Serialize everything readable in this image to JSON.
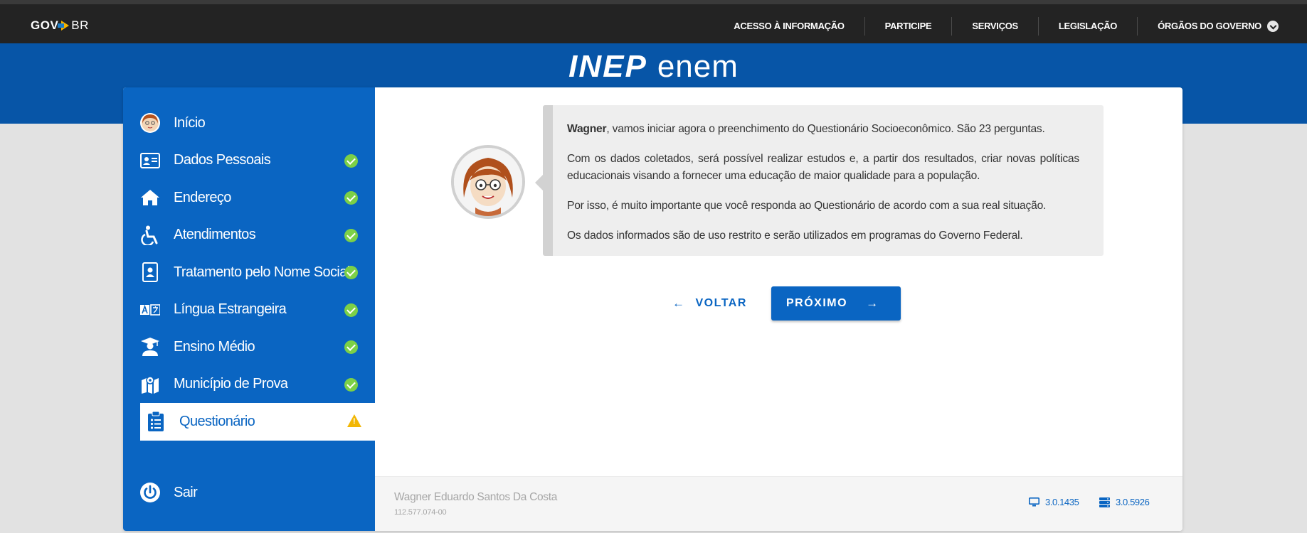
{
  "gov_bar": {
    "logo_gov": "GOV",
    "logo_br": "BR",
    "nav": [
      "ACESSO À INFORMAÇÃO",
      "PARTICIPE",
      "SERVIÇOS",
      "LEGISLAÇÃO",
      "ÓRGÃOS DO GOVERNO"
    ]
  },
  "brand": {
    "inep": "INEP",
    "enem": "enem"
  },
  "sidebar": {
    "items": [
      {
        "label": "Início",
        "icon": "avatar-icon",
        "status": "none"
      },
      {
        "label": "Dados Pessoais",
        "icon": "id-card-icon",
        "status": "complete"
      },
      {
        "label": "Endereço",
        "icon": "home-icon",
        "status": "complete"
      },
      {
        "label": "Atendimentos",
        "icon": "accessibility-icon",
        "status": "complete"
      },
      {
        "label": "Tratamento pelo Nome Social",
        "icon": "badge-icon",
        "status": "complete"
      },
      {
        "label": "Língua Estrangeira",
        "icon": "language-icon",
        "status": "complete"
      },
      {
        "label": "Ensino Médio",
        "icon": "graduate-icon",
        "status": "complete"
      },
      {
        "label": "Município de Prova",
        "icon": "map-icon",
        "status": "complete"
      },
      {
        "label": "Questionário",
        "icon": "clipboard-list-icon",
        "status": "warning"
      }
    ],
    "logout": "Sair",
    "colors": {
      "complete": "#7cd047",
      "warning": "#f2b705"
    }
  },
  "message": {
    "name": "Wagner",
    "intro_rest": ", vamos iniciar agora o preenchimento do Questionário Socioeconômico. São 23 perguntas.",
    "p2": "Com os dados coletados, será possível realizar estudos e, a partir dos resultados, criar novas políticas educacionais visando a fornecer uma educação de maior qualidade para a população.",
    "p3": "Por isso, é muito importante que você responda ao Questionário de acordo com a sua real situação.",
    "p4": "Os dados informados são de uso restrito e serão utilizados em programas do Governo Federal."
  },
  "buttons": {
    "back": "VOLTAR",
    "next": "PRÓXIMO"
  },
  "footer": {
    "user_name": "Wagner Eduardo Santos Da Costa",
    "user_cpf": "112.577.074-00",
    "version_client": "3.0.1435",
    "version_server": "3.0.5926"
  },
  "accent_color": "#0a65c2"
}
